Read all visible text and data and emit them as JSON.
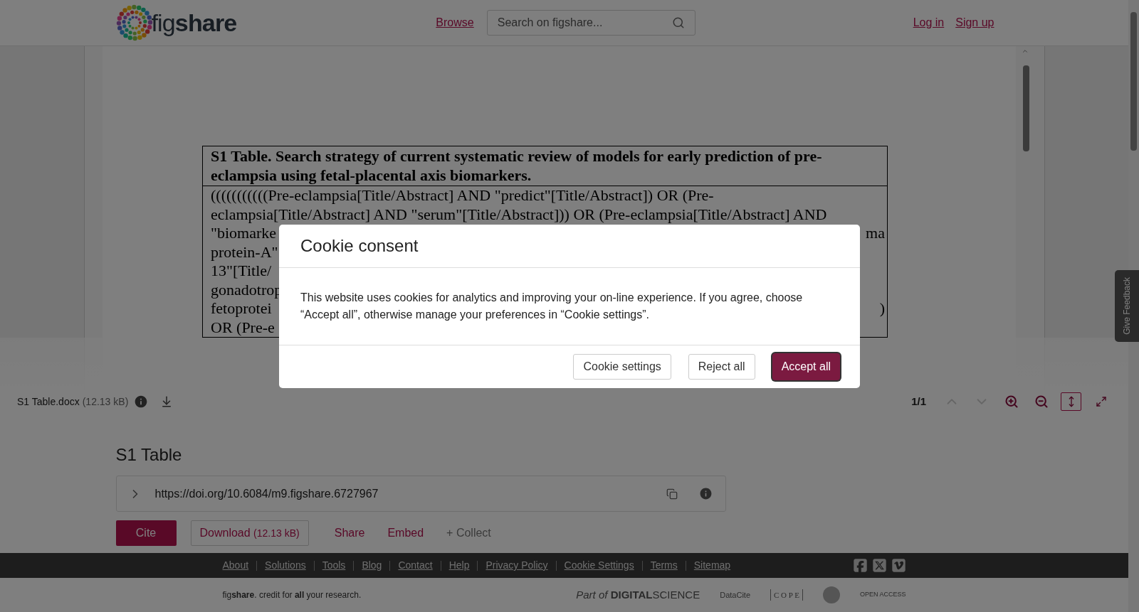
{
  "header": {
    "logo_text": "fig**share**",
    "nav_link": "Browse",
    "search": {
      "placeholder": "Search on figshare..."
    },
    "auth_links": [
      "Log in",
      "Sign up"
    ]
  },
  "document": {
    "title": "S1 Table. Search strategy of current systematic review of models for early prediction of pre-eclampsia using fetal-placental axis biomarkers.",
    "lines": [
      {
        "left": "(((((((((((Pre-eclampsia[Title/Abstract] AND \"predict\"[Title/Abstract]) OR (Pre-"
      },
      {
        "left": "eclampsia[Title/Abstract] AND \"serum\"[Title/Abstract])) OR (Pre-eclampsia[Title/Abstract] AND"
      },
      {
        "left": "\"biomarke",
        "right": "ma"
      },
      {
        "left": "protein-A\""
      },
      {
        "left": "13\"[Title/"
      },
      {
        "left": "gonadotrop"
      },
      {
        "left": "fetoprotei",
        "right": ")"
      },
      {
        "left": "OR (Pre-e"
      }
    ]
  },
  "viewer_toolbar": {
    "file_name": "S1 Table.docx",
    "file_size": "(12.13 kB)",
    "page": "1/1",
    "tools": [
      {
        "kind": "up",
        "disabled": true,
        "selected": false
      },
      {
        "kind": "down",
        "disabled": true,
        "selected": false
      },
      {
        "kind": "zoom-in",
        "disabled": false,
        "selected": false
      },
      {
        "kind": "zoom-out",
        "disabled": false,
        "selected": false
      },
      {
        "kind": "fit-height",
        "disabled": false,
        "selected": true
      },
      {
        "kind": "fullscreen",
        "disabled": false,
        "selected": false
      }
    ]
  },
  "item": {
    "title": "S1 Table",
    "doi": "https://doi.org/10.6084/m9.figshare.6727967",
    "actions": [
      {
        "kind": "primary",
        "label": "Cite"
      },
      {
        "kind": "outline",
        "label": "Download",
        "size": "(12.13 kB)"
      },
      {
        "kind": "link",
        "label": "Share"
      },
      {
        "kind": "link",
        "label": "Embed"
      },
      {
        "kind": "muted",
        "label": "+ Collect"
      }
    ]
  },
  "footer": {
    "links": [
      "About",
      "Solutions",
      "Tools",
      "Blog",
      "Contact",
      "Help",
      "Privacy Policy",
      "Cookie Settings",
      "Terms",
      "Sitemap"
    ],
    "tagline": "fig**share**. credit for **all** your research.",
    "partners": [
      {
        "kind": "digital-science",
        "text": "*Part of* **DIGITAL**SCIENCE"
      },
      {
        "kind": "datacite",
        "text": "DataCite"
      },
      {
        "kind": "cope",
        "text": "C O P E"
      },
      {
        "kind": "seal"
      },
      {
        "kind": "open-access",
        "text": "OPEN ACCESS"
      }
    ]
  },
  "feedback_tab": "Give Feedback",
  "cookie_dialog": {
    "title": "Cookie consent",
    "message": "This website uses cookies for analytics and improving your on-line experience. If you agree, choose “Accept all”, otherwise manage your preferences in “Cookie settings”.",
    "buttons": [
      {
        "kind": "secondary",
        "label": "Cookie settings"
      },
      {
        "kind": "secondary",
        "label": "Reject all"
      },
      {
        "kind": "primary",
        "label": "Accept all"
      }
    ]
  }
}
